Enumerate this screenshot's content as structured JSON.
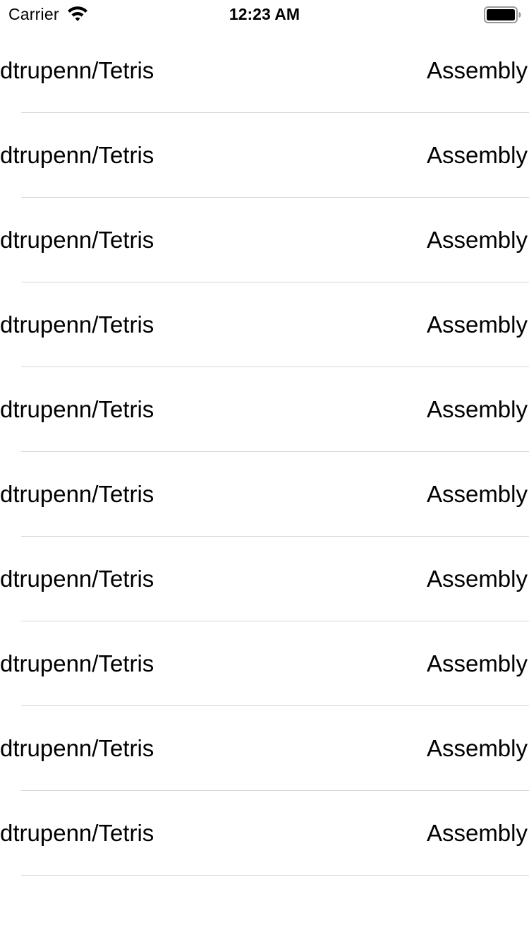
{
  "status_bar": {
    "carrier": "Carrier",
    "time": "12:23 AM",
    "icons": [
      "wifi-icon",
      "battery-icon"
    ]
  },
  "repos": [
    {
      "name": "dtrupenn/Tetris",
      "language": "Assembly"
    },
    {
      "name": "dtrupenn/Tetris",
      "language": "Assembly"
    },
    {
      "name": "dtrupenn/Tetris",
      "language": "Assembly"
    },
    {
      "name": "dtrupenn/Tetris",
      "language": "Assembly"
    },
    {
      "name": "dtrupenn/Tetris",
      "language": "Assembly"
    },
    {
      "name": "dtrupenn/Tetris",
      "language": "Assembly"
    },
    {
      "name": "dtrupenn/Tetris",
      "language": "Assembly"
    },
    {
      "name": "dtrupenn/Tetris",
      "language": "Assembly"
    },
    {
      "name": "dtrupenn/Tetris",
      "language": "Assembly"
    },
    {
      "name": "dtrupenn/Tetris",
      "language": "Assembly"
    }
  ],
  "colors": {
    "background": "#ffffff",
    "text": "#000000",
    "separator": "#d6d6d8"
  }
}
